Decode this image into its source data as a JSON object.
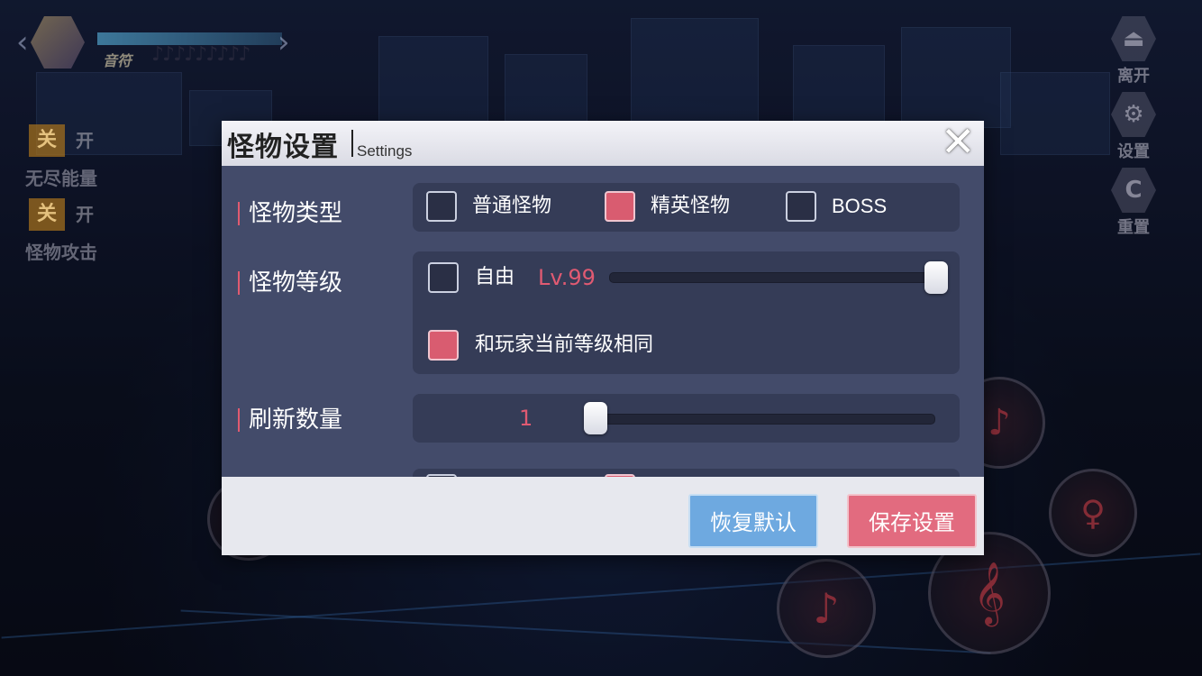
{
  "hud": {
    "player_name": "音符",
    "notes_glyphs": "♪♪♪♪♪♪♪♪♪"
  },
  "left_toggles": [
    {
      "key": "关",
      "state": "开",
      "label": "无尽能量"
    },
    {
      "key": "关",
      "state": "开",
      "label": "怪物攻击"
    }
  ],
  "right_menu": [
    {
      "icon": "exit-icon",
      "glyph": "⏏",
      "label": "离开"
    },
    {
      "icon": "gear-icon",
      "glyph": "⚙",
      "label": "设置"
    },
    {
      "icon": "reset-icon",
      "glyph": "C",
      "label": "重置"
    }
  ],
  "skills": {
    "note_glyph": "♪",
    "clef_glyph": "𝄞",
    "dancer_glyph": "♀"
  },
  "dialog": {
    "title": "怪物设置",
    "subtitle": "Settings",
    "close_glyph": "✕",
    "monster_type": {
      "label": "怪物类型",
      "options": [
        {
          "label": "普通怪物",
          "checked": false
        },
        {
          "label": "精英怪物",
          "checked": true
        },
        {
          "label": "BOSS",
          "checked": false
        }
      ]
    },
    "monster_level": {
      "label": "怪物等级",
      "free_label": "自由",
      "free_checked": false,
      "level_text": "Lv.99",
      "level_value": 99,
      "level_fraction": 1.0,
      "same_level_label": "和玩家当前等级相同",
      "same_level_checked": true
    },
    "spawn_count": {
      "label": "刷新数量",
      "value_text": "1",
      "value": 1,
      "fraction": 0.0
    },
    "buttons": {
      "restore": "恢复默认",
      "save": "保存设置"
    }
  },
  "colors": {
    "accent_pink": "#e05a72",
    "button_blue": "#6ea9e0",
    "panel_dark": "#353c57",
    "body_bg": "#434b6a"
  }
}
